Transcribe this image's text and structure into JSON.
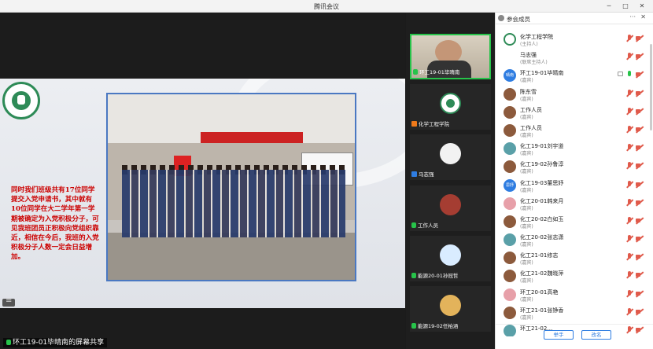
{
  "window": {
    "title": "腾讯会议",
    "minimize_icon": "minimize-icon",
    "restore_icon": "restore-icon",
    "close_icon": "close-icon"
  },
  "slide": {
    "text": "同时我们班级共有17位同学提交入党申请书，其中就有10位同学在大二学年第一学期被确定为入党积极分子，可见我班团员正积极向党组织靠近，相信在今后，我班的入党积极分子人数一定会日益增加。",
    "share_label": "环工19-01毕晴南的屏幕共享"
  },
  "video_tiles": [
    {
      "label": "环工19-01毕晴南",
      "icon": "mic-icon",
      "active": true
    },
    {
      "label": "化学工程学院",
      "icon": "user-icon"
    },
    {
      "label": "马志强",
      "icon": "user-icon"
    },
    {
      "label": "工作人员",
      "icon": "mic-icon"
    },
    {
      "label": "能源20-01孙冠哲",
      "icon": "mic-icon"
    },
    {
      "label": "能源19-02任柏涵",
      "icon": "mic-icon"
    }
  ],
  "members_panel": {
    "title": "参会成员",
    "more_icon": "more-icon",
    "close_icon": "close-icon",
    "members": [
      {
        "name": "化学工程学院",
        "role": "(主持人)",
        "avatar": "green"
      },
      {
        "name": "马志强",
        "role": "(联席主持人)",
        "avatar": "blank"
      },
      {
        "name": "环工19-01毕晴南",
        "role": "(嘉宾)",
        "avatar": "blue",
        "avatar_text": "晴南",
        "mic_on": true
      },
      {
        "name": "陈东雪",
        "role": "(嘉宾)",
        "avatar": "brown"
      },
      {
        "name": "工作人员",
        "role": "(嘉宾)",
        "avatar": "brown"
      },
      {
        "name": "工作人员",
        "role": "(嘉宾)",
        "avatar": "brown"
      },
      {
        "name": "化工19-01刘宇道",
        "role": "(嘉宾)",
        "avatar": "teal"
      },
      {
        "name": "化工19-02孙鲁淳",
        "role": "(嘉宾)",
        "avatar": "brown"
      },
      {
        "name": "化工19-03董思妤",
        "role": "(嘉宾)",
        "avatar": "blue",
        "avatar_text": "思妤"
      },
      {
        "name": "化工20-01韩来月",
        "role": "(嘉宾)",
        "avatar": "pink"
      },
      {
        "name": "化工20-02白如玉",
        "role": "(嘉宾)",
        "avatar": "brown"
      },
      {
        "name": "化工20-02张志潇",
        "role": "(嘉宾)",
        "avatar": "teal"
      },
      {
        "name": "化工21-01修志",
        "role": "(嘉宾)",
        "avatar": "brown"
      },
      {
        "name": "化工21-02魏晓萍",
        "role": "(嘉宾)",
        "avatar": "brown"
      },
      {
        "name": "环工20-01高艳",
        "role": "(嘉宾)",
        "avatar": "pink"
      },
      {
        "name": "环工21-01张铮香",
        "role": "(嘉宾)",
        "avatar": "brown"
      },
      {
        "name": "环工21-02…",
        "role": "",
        "avatar": "teal"
      }
    ],
    "raise_hand_label": "举手",
    "rename_label": "改名"
  }
}
